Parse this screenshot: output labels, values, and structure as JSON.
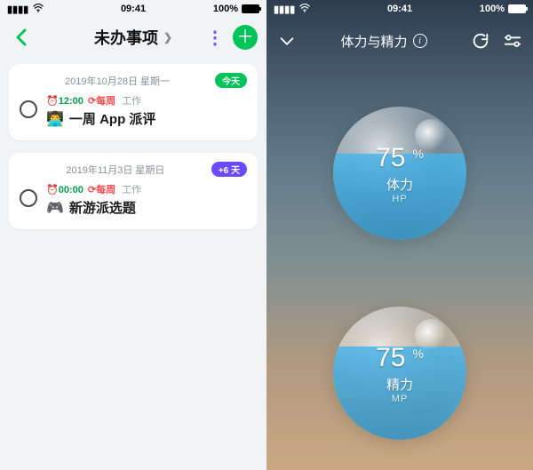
{
  "status": {
    "time": "09:41",
    "battery": "100%"
  },
  "left": {
    "title": "未办事项",
    "cards": [
      {
        "date": "2019年10月28日 星期一",
        "badge": "今天",
        "badge_color": "green",
        "meta_time_icon": "⏰",
        "meta_time": "12:00",
        "meta_repeat_icon": "⟳",
        "meta_repeat": "每周",
        "meta_ctx": "工作",
        "emoji": "👨‍💻",
        "title": "一周 App 派评"
      },
      {
        "date": "2019年11月3日 星期日",
        "badge": "+6 天",
        "badge_color": "purple",
        "meta_time_icon": "⏰",
        "meta_time": "00:00",
        "meta_repeat_icon": "⟳",
        "meta_repeat": "每周",
        "meta_ctx": "工作",
        "emoji": "🎮",
        "title": "新游派选题"
      }
    ]
  },
  "right": {
    "title": "体力与精力",
    "stats": [
      {
        "id": "hp",
        "value": "75",
        "unit": "%",
        "label": "体力",
        "sub": "HP",
        "fill_pct": 65
      },
      {
        "id": "mp",
        "value": "75",
        "unit": "%",
        "label": "精力",
        "sub": "MP",
        "fill_pct": 70
      }
    ]
  }
}
